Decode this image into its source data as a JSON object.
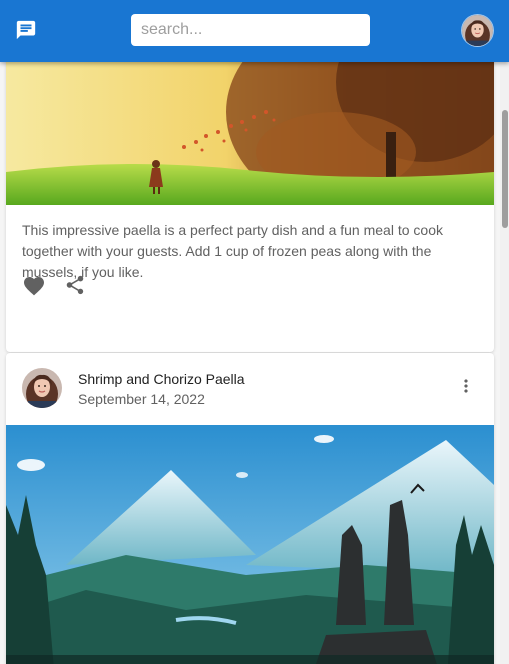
{
  "appbar": {
    "icon": "chat-icon",
    "search_placeholder": "search...",
    "search_value": "",
    "color": "#1976d2",
    "avatar": "user-avatar"
  },
  "cards": [
    {
      "image": "landscape-girl-autumn-illustration",
      "description": "This impressive paella is a perfect party dish and a fun meal to cook together with your guests. Add 1 cup of frozen peas along with the mussels, if you like.",
      "actions": {
        "favorite_icon": "heart-icon",
        "share_icon": "share-icon"
      }
    },
    {
      "avatar": "user-avatar",
      "title": "Shrimp and Chorizo Paella",
      "subheader": "September 14, 2022",
      "more_icon": "more-vert-icon",
      "image": "mountain-forest-illustration"
    }
  ]
}
